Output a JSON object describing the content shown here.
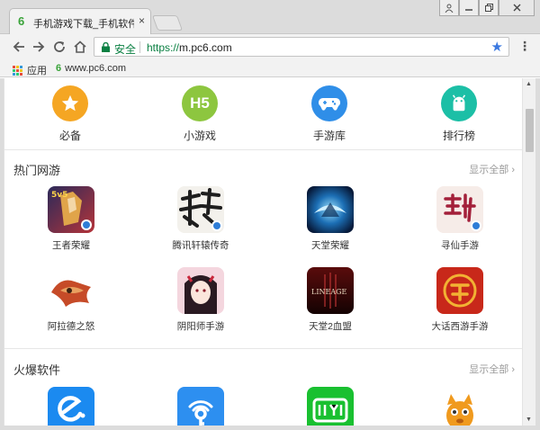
{
  "browser": {
    "tab_title": "手机游戏下载_手机软件",
    "tab_favicon": "6",
    "close_glyph": "×",
    "url_scheme": "https://",
    "url_host": "m.pc6.com",
    "secure_label": "安全",
    "bookmarks": [
      {
        "label": "应用",
        "icon": "apps-grid-icon"
      },
      {
        "label": "www.pc6.com",
        "favicon": "6"
      }
    ]
  },
  "colors": {
    "accent_orange": "#f5a623",
    "accent_green": "#8dc63f",
    "accent_blue": "#2f8ee8",
    "accent_teal": "#1cbfa6",
    "secure_green": "#0b8043"
  },
  "categories": [
    {
      "label": "必备",
      "icon": "star-icon",
      "text": "★"
    },
    {
      "label": "小游戏",
      "icon": "h5-icon",
      "text": "H5"
    },
    {
      "label": "手游库",
      "icon": "gamepad-icon",
      "text": ""
    },
    {
      "label": "排行榜",
      "icon": "android-icon",
      "text": ""
    }
  ],
  "hot_games": {
    "title": "热门网游",
    "more": "显示全部",
    "chevron": "›",
    "items": [
      {
        "name": "王者荣耀",
        "icon": "kings-glory-icon"
      },
      {
        "name": "腾讯轩辕传奇",
        "icon": "xuanyuan-icon"
      },
      {
        "name": "天堂荣耀",
        "icon": "tiantang-glory-icon"
      },
      {
        "name": "寻仙手游",
        "icon": "xunxian-icon"
      },
      {
        "name": "阿拉德之怒",
        "icon": "alade-icon"
      },
      {
        "name": "阴阳师手游",
        "icon": "onmyoji-icon"
      },
      {
        "name": "天堂2血盟",
        "icon": "lineage2-icon"
      },
      {
        "name": "大话西游手游",
        "icon": "dahua-xiyou-icon"
      }
    ]
  },
  "hot_software": {
    "title": "火爆软件",
    "more": "显示全部",
    "chevron": "›"
  }
}
